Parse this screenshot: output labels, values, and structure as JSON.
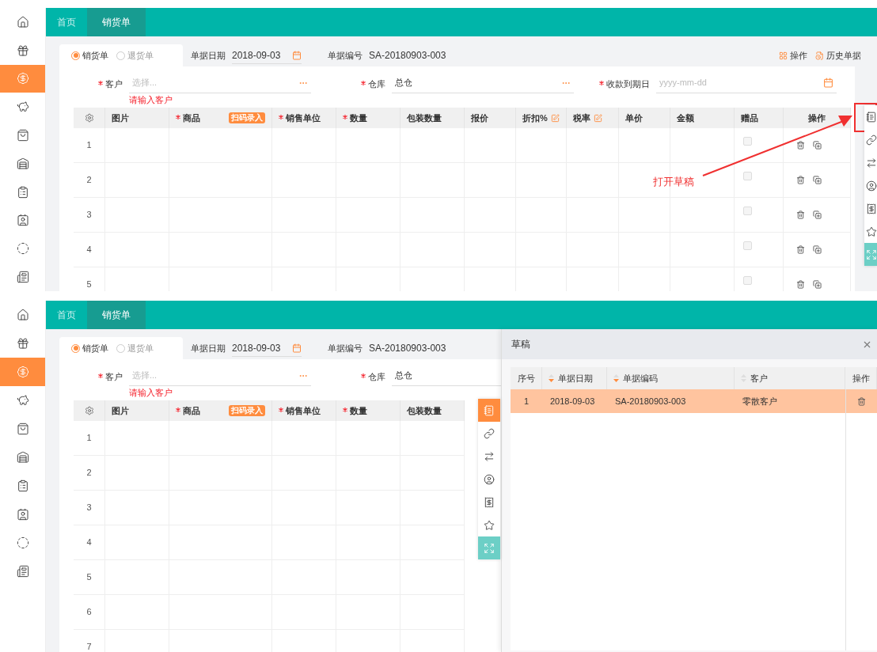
{
  "screens": [
    {
      "sidebar": {
        "items": [
          {
            "selected": false
          },
          {
            "selected": false
          },
          {
            "selected": true
          },
          {
            "selected": false
          },
          {
            "selected": false
          },
          {
            "selected": false
          },
          {
            "selected": false
          },
          {
            "selected": false
          },
          {
            "selected": false
          },
          {
            "selected": false
          }
        ]
      },
      "tabs": [
        {
          "label": "首页",
          "selected": false
        },
        {
          "label": "销货单",
          "selected": true
        }
      ],
      "order_types": [
        {
          "label": "销货单",
          "selected": true
        },
        {
          "label": "退货单",
          "selected": false
        }
      ],
      "date": {
        "label": "单据日期",
        "value": "2018-09-03"
      },
      "number": {
        "label": "单据编号",
        "value": "SA-20180903-003"
      },
      "actions": [
        {
          "kind": "grid",
          "label": "操作"
        },
        {
          "kind": "history",
          "label": "历史单据"
        }
      ],
      "fields": [
        {
          "kind": "picker",
          "label": "客户",
          "required": true,
          "placeholder": "选择...",
          "error": "请输入客户"
        },
        {
          "kind": "picker",
          "label": "仓库",
          "required": true,
          "value": "总仓"
        },
        {
          "kind": "date",
          "label": "收款到期日",
          "required": true,
          "placeholder": "yyyy-mm-dd"
        }
      ],
      "table": {
        "columns": [
          {
            "kind": "settings"
          },
          {
            "kind": "text",
            "label": "图片",
            "required": false,
            "editable": false
          },
          {
            "kind": "text",
            "label": "商品",
            "required": true,
            "editable": false,
            "badge": "扫码录入"
          },
          {
            "kind": "text",
            "label": "销售单位",
            "required": true,
            "editable": false
          },
          {
            "kind": "text",
            "label": "数量",
            "required": true,
            "editable": false
          },
          {
            "kind": "text",
            "label": "包装数量",
            "required": false,
            "editable": false
          },
          {
            "kind": "text",
            "label": "报价",
            "required": false,
            "editable": false
          },
          {
            "kind": "text",
            "label": "折扣%",
            "required": false,
            "editable": true
          },
          {
            "kind": "text",
            "label": "税率",
            "required": false,
            "editable": true
          },
          {
            "kind": "text",
            "label": "单价",
            "required": false,
            "editable": false
          },
          {
            "kind": "text",
            "label": "金额",
            "required": false,
            "editable": false
          },
          {
            "kind": "gift",
            "label": "赠品",
            "required": false,
            "editable": false
          },
          {
            "kind": "actions",
            "label": "操作",
            "required": false,
            "editable": false
          }
        ],
        "rows": [
          {
            "number": "1",
            "checked": false
          },
          {
            "number": "2",
            "checked": false
          },
          {
            "number": "3",
            "checked": false
          },
          {
            "number": "4",
            "checked": false
          },
          {
            "number": "5",
            "checked": false
          }
        ]
      },
      "side_toolbar": [
        {
          "selected": false
        },
        {
          "selected": false
        },
        {
          "selected": false
        },
        {
          "selected": false
        },
        {
          "selected": false
        },
        {
          "selected": false
        },
        {
          "selected": false
        }
      ],
      "annotation": {
        "text": "打开草稿"
      }
    },
    {
      "sidebar": {
        "items": [
          {
            "selected": false
          },
          {
            "selected": false
          },
          {
            "selected": true
          },
          {
            "selected": false
          },
          {
            "selected": false
          },
          {
            "selected": false
          },
          {
            "selected": false
          },
          {
            "selected": false
          },
          {
            "selected": false
          },
          {
            "selected": false
          }
        ]
      },
      "tabs": [
        {
          "label": "首页",
          "selected": false
        },
        {
          "label": "销货单",
          "selected": true
        }
      ],
      "order_types": [
        {
          "label": "销货单",
          "selected": true
        },
        {
          "label": "退货单",
          "selected": false
        }
      ],
      "date": {
        "label": "单据日期",
        "value": "2018-09-03"
      },
      "number": {
        "label": "单据编号",
        "value": "SA-20180903-003"
      },
      "fields": [
        {
          "kind": "picker",
          "label": "客户",
          "required": true,
          "placeholder": "选择...",
          "error": "请输入客户"
        },
        {
          "kind": "picker",
          "label": "仓库",
          "required": true,
          "value": "总仓"
        }
      ],
      "table": {
        "columns": [
          {
            "kind": "settings"
          },
          {
            "kind": "text",
            "label": "图片",
            "required": false,
            "editable": false
          },
          {
            "kind": "text",
            "label": "商品",
            "required": true,
            "editable": false,
            "badge": "扫码录入"
          },
          {
            "kind": "text",
            "label": "销售单位",
            "required": true,
            "editable": false
          },
          {
            "kind": "text",
            "label": "数量",
            "required": true,
            "editable": false
          },
          {
            "kind": "text",
            "label": "包装数量",
            "required": false,
            "editable": false
          }
        ],
        "rows": [
          {
            "number": "1"
          },
          {
            "number": "2"
          },
          {
            "number": "3"
          },
          {
            "number": "4"
          },
          {
            "number": "5"
          },
          {
            "number": "6"
          },
          {
            "number": "7"
          }
        ]
      },
      "side_toolbar": [
        {
          "selected": true
        },
        {
          "selected": false
        },
        {
          "selected": false
        },
        {
          "selected": false
        },
        {
          "selected": false
        },
        {
          "selected": false
        },
        {
          "selected": false
        }
      ],
      "draft_panel": {
        "title": "草稿",
        "columns": [
          {
            "label": "序号",
            "sortable": false
          },
          {
            "label": "单据日期",
            "sortable": true,
            "sorted": true
          },
          {
            "label": "单据编码",
            "sortable": true,
            "sorted": true
          },
          {
            "label": "客户",
            "sortable": true,
            "sorted": false
          },
          {
            "label": "操作",
            "sortable": false
          }
        ],
        "rows": [
          {
            "cells": [
              "1",
              "2018-09-03",
              "SA-20180903-003",
              "零散客户"
            ],
            "selected": true
          }
        ]
      }
    }
  ]
}
